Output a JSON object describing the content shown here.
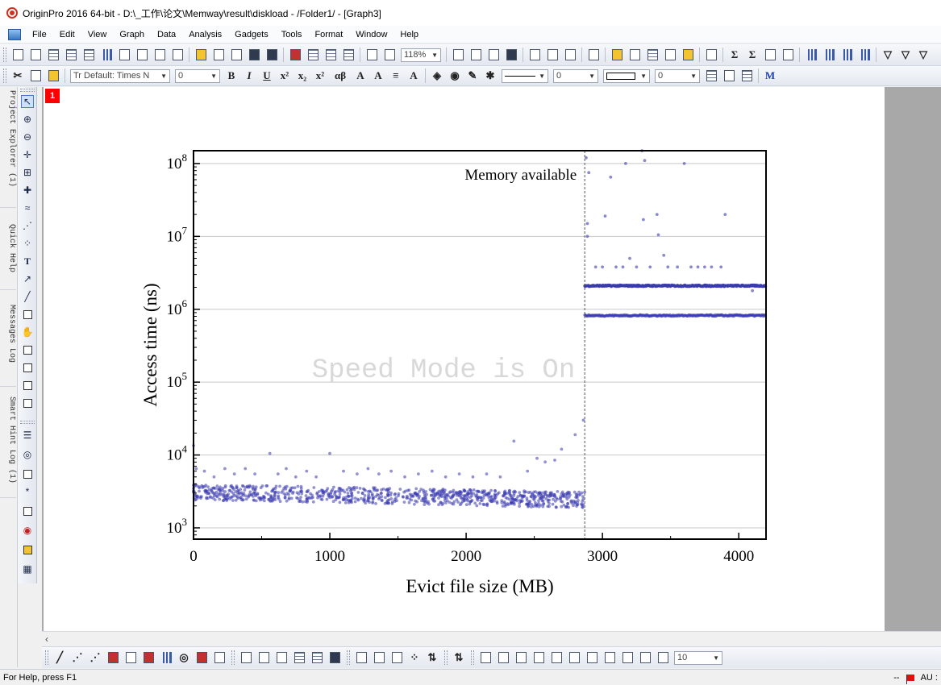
{
  "window": {
    "title": "OriginPro 2016 64-bit - D:\\_工作\\论文\\Memway\\result\\diskload - /Folder1/ - [Graph3]"
  },
  "menu": [
    "File",
    "Edit",
    "View",
    "Graph",
    "Data",
    "Analysis",
    "Gadgets",
    "Tools",
    "Format",
    "Window",
    "Help"
  ],
  "toolbar": {
    "zoom_value": "118%",
    "font_name": "Tr Default: Times N",
    "font_size": "0",
    "line_width": "0",
    "border_width": "0",
    "text_bold": "B",
    "text_italic": "I",
    "text_underline": "U",
    "greek": "αβ",
    "bottom_value": "10"
  },
  "dock_tabs": [
    "Project Explorer (1)",
    "Quick Help",
    "Messages Log",
    "Smart Hint Log (1)"
  ],
  "layer": {
    "number": "1"
  },
  "watermark": "Speed Mode is On",
  "statusbar": {
    "help": "For Help, press F1",
    "dashes": "--",
    "au": "AU :"
  },
  "colors": {
    "series": "#3a3ab0",
    "grid": "#c8c8c8",
    "watermark": "#d8d8d8",
    "layer_badge": "#ff0000"
  },
  "chart_data": {
    "type": "scatter",
    "xlabel": "Evict file size (MB)",
    "ylabel": "Access time (ns)",
    "xlim": [
      0,
      4200
    ],
    "ylim": [
      700,
      150000000
    ],
    "y_scale": "log",
    "x_ticks": [
      "0",
      "1000",
      "2000",
      "3000",
      "4000"
    ],
    "y_ticks": [
      "10^3",
      "10^4",
      "10^5",
      "10^6",
      "10^7",
      "10^8"
    ],
    "grid": "horizontal",
    "annotation": {
      "text": "Memory available",
      "x": 2870
    },
    "series": [
      {
        "points_description_x": [
          0,
          2870
        ],
        "low_band": {
          "x_from": 0,
          "x_to": 2870,
          "y_center": 2600,
          "y_spread": [
            2000,
            3500
          ]
        },
        "scatter": [
          [
            0,
            13500
          ],
          [
            20,
            6500
          ],
          [
            80,
            6000
          ],
          [
            150,
            5000
          ],
          [
            230,
            6500
          ],
          [
            300,
            5500
          ],
          [
            380,
            6500
          ],
          [
            450,
            5500
          ],
          [
            560,
            10500
          ],
          [
            620,
            5500
          ],
          [
            680,
            6500
          ],
          [
            750,
            5000
          ],
          [
            830,
            6000
          ],
          [
            900,
            5000
          ],
          [
            1000,
            10500
          ],
          [
            1100,
            6000
          ],
          [
            1200,
            5500
          ],
          [
            1280,
            6500
          ],
          [
            1360,
            5500
          ],
          [
            1450,
            6000
          ],
          [
            1550,
            5000
          ],
          [
            1650,
            5500
          ],
          [
            1750,
            6000
          ],
          [
            1850,
            5000
          ],
          [
            1950,
            5500
          ],
          [
            2050,
            5000
          ],
          [
            2150,
            5500
          ],
          [
            2250,
            5000
          ],
          [
            2350,
            15500
          ],
          [
            2450,
            6000
          ],
          [
            2520,
            9000
          ],
          [
            2580,
            8000
          ],
          [
            2650,
            8500
          ],
          [
            2700,
            12000
          ],
          [
            2800,
            19000
          ],
          [
            2860,
            30000
          ]
        ]
      },
      {
        "band_2e6": {
          "x_from": 2870,
          "x_to": 4200,
          "y": 2100000
        },
        "band_8e5": {
          "x_from": 2870,
          "x_to": 4200,
          "y": 820000
        },
        "scatter": [
          [
            2880,
            120000000
          ],
          [
            2900,
            75000000
          ],
          [
            2890,
            15000000
          ],
          [
            2890,
            10000000
          ],
          [
            2950,
            3800000
          ],
          [
            3000,
            3800000
          ],
          [
            3020,
            19000000
          ],
          [
            3060,
            65000000
          ],
          [
            3100,
            3800000
          ],
          [
            3150,
            3800000
          ],
          [
            3170,
            100000000
          ],
          [
            3200,
            5000000
          ],
          [
            3250,
            3800000
          ],
          [
            3290,
            150000000
          ],
          [
            3310,
            110000000
          ],
          [
            3300,
            17000000
          ],
          [
            3350,
            3800000
          ],
          [
            3400,
            20000000
          ],
          [
            3410,
            10500000
          ],
          [
            3450,
            5500000
          ],
          [
            3480,
            3800000
          ],
          [
            3550,
            3800000
          ],
          [
            3600,
            100000000
          ],
          [
            3650,
            3800000
          ],
          [
            3700,
            3800000
          ],
          [
            3750,
            3800000
          ],
          [
            3800,
            3800000
          ],
          [
            3870,
            3800000
          ],
          [
            3900,
            20000000
          ],
          [
            4100,
            1800000
          ]
        ]
      }
    ]
  }
}
